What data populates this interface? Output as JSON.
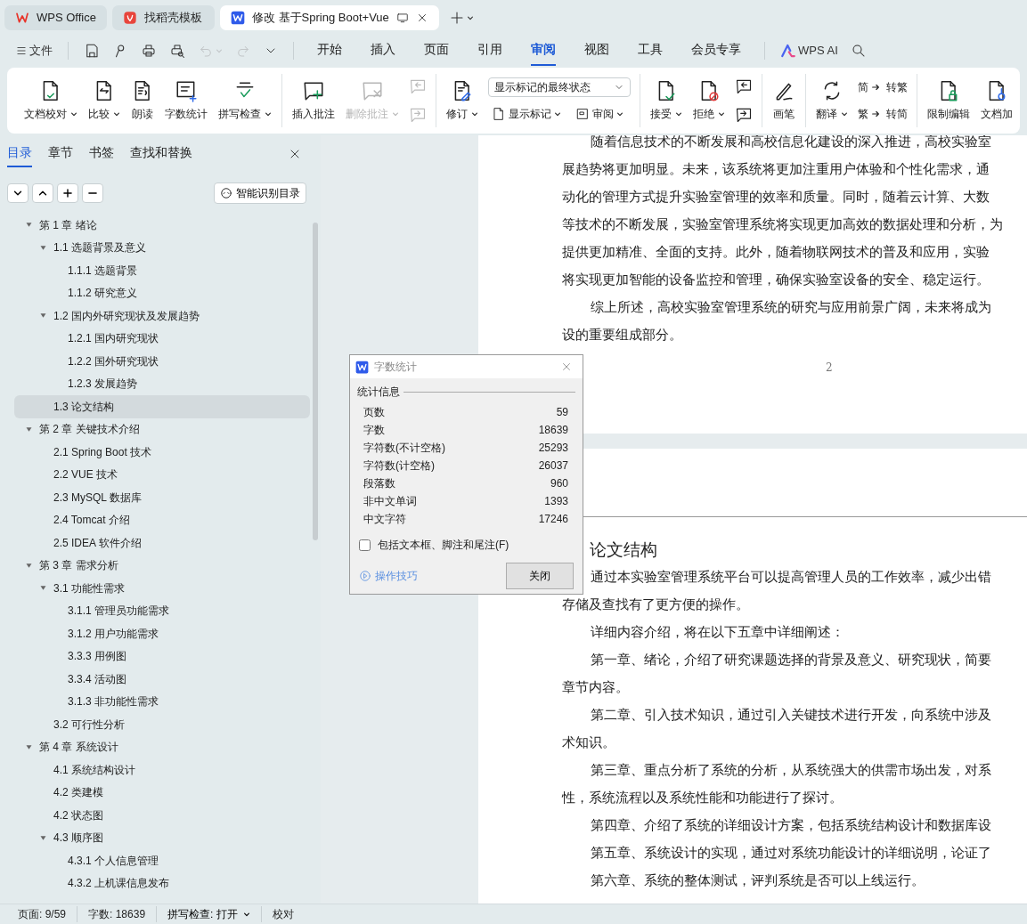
{
  "app_tabs": [
    {
      "label": "WPS Office",
      "kind": "home",
      "selected": false
    },
    {
      "label": "找稻壳模板",
      "kind": "template",
      "selected": false
    },
    {
      "label": "修改 基于Spring Boot+Vue",
      "kind": "document",
      "selected": true
    }
  ],
  "menu": {
    "file": "文件",
    "quick": [
      {
        "disabled": false
      },
      {
        "disabled": false
      },
      {
        "disabled": false
      },
      {
        "disabled": false
      },
      {
        "disabled": true
      },
      {
        "disabled": true
      }
    ],
    "tabs": [
      {
        "label": "开始",
        "selected": false
      },
      {
        "label": "插入",
        "selected": false
      },
      {
        "label": "页面",
        "selected": false
      },
      {
        "label": "引用",
        "selected": false
      },
      {
        "label": "审阅",
        "selected": true
      },
      {
        "label": "视图",
        "selected": false
      },
      {
        "label": "工具",
        "selected": false
      },
      {
        "label": "会员专享",
        "selected": false
      }
    ],
    "ai": "WPS AI"
  },
  "ribbon": [
    [
      {
        "kind": "large",
        "label": "文档校对",
        "caret": true,
        "disabled": false
      },
      {
        "kind": "large",
        "label": "比较",
        "caret": true,
        "disabled": false
      },
      {
        "kind": "large",
        "label": "朗读",
        "caret": false,
        "disabled": false
      },
      {
        "kind": "large",
        "label": "字数统计",
        "caret": false,
        "disabled": false
      },
      {
        "kind": "large",
        "label": "拼写检查",
        "caret": true,
        "disabled": false
      }
    ],
    [
      {
        "kind": "large",
        "label": "插入批注",
        "caret": false,
        "disabled": false
      },
      {
        "kind": "large",
        "label": "删除批注",
        "caret": true,
        "disabled": true
      },
      {
        "kind": "stack",
        "items": [
          {
            "disabled": true
          },
          {
            "disabled": true
          }
        ]
      }
    ],
    [
      {
        "kind": "large",
        "label": "修订",
        "caret": true,
        "disabled": false
      },
      {
        "kind": "select",
        "value": "显示标记的最终状态",
        "buttons": [
          {
            "label": "显示标记",
            "caret": true
          },
          {
            "label": "审阅",
            "caret": true
          }
        ]
      }
    ],
    [
      {
        "kind": "large",
        "label": "接受",
        "caret": true,
        "disabled": false
      },
      {
        "kind": "large",
        "label": "拒绝",
        "caret": true,
        "disabled": false
      },
      {
        "kind": "stack",
        "items": [
          {
            "disabled": false
          },
          {
            "disabled": false
          }
        ]
      }
    ],
    [
      {
        "kind": "large",
        "label": "画笔",
        "caret": false,
        "disabled": false
      }
    ],
    [
      {
        "kind": "large",
        "label": "翻译",
        "caret": true,
        "disabled": false
      },
      {
        "kind": "stack",
        "items": [
          {
            "glyph": "简",
            "label": "转繁",
            "disabled": false
          },
          {
            "glyph": "繁",
            "label": "转简",
            "disabled": false
          }
        ]
      }
    ],
    [
      {
        "kind": "large",
        "label": "限制编辑",
        "caret": false,
        "disabled": false
      },
      {
        "kind": "large",
        "label": "文档加",
        "caret": false,
        "disabled": false
      }
    ]
  ],
  "sidebar": {
    "tabs": [
      {
        "label": "目录",
        "selected": true
      },
      {
        "label": "章节",
        "selected": false
      },
      {
        "label": "书签",
        "selected": false
      },
      {
        "label": "查找和替换",
        "selected": false
      }
    ],
    "smart_button": "智能识别目录",
    "tree": [
      {
        "label": "第 1 章  绪论",
        "expanded": true,
        "selected": false,
        "children": [
          {
            "label": "1.1 选题背景及意义",
            "expanded": true,
            "selected": false,
            "children": [
              {
                "label": "1.1.1 选题背景",
                "selected": false
              },
              {
                "label": "1.1.2  研究意义",
                "selected": false
              }
            ]
          },
          {
            "label": "1.2 国内外研究现状及发展趋势",
            "expanded": true,
            "selected": false,
            "children": [
              {
                "label": "1.2.1 国内研究现状",
                "selected": false
              },
              {
                "label": "1.2.2 国外研究现状",
                "selected": false
              },
              {
                "label": "1.2.3 发展趋势",
                "selected": false
              }
            ]
          },
          {
            "label": "1.3 论文结构",
            "selected": true
          }
        ]
      },
      {
        "label": "第 2 章  关键技术介绍",
        "expanded": true,
        "selected": false,
        "children": [
          {
            "label": "2.1 Spring Boot 技术",
            "selected": false
          },
          {
            "label": "2.2 VUE 技术",
            "selected": false
          },
          {
            "label": "2.3 MySQL 数据库",
            "selected": false
          },
          {
            "label": "2.4 Tomcat 介绍",
            "selected": false
          },
          {
            "label": "2.5 IDEA 软件介绍",
            "selected": false
          }
        ]
      },
      {
        "label": "第 3 章  需求分析",
        "expanded": true,
        "selected": false,
        "children": [
          {
            "label": "3.1  功能性需求",
            "expanded": true,
            "selected": false,
            "children": [
              {
                "label": "3.1.1  管理员功能需求",
                "selected": false
              },
              {
                "label": "3.1.2  用户功能需求",
                "selected": false
              },
              {
                "label": "3.3.3 用例图",
                "selected": false
              },
              {
                "label": "3.3.4 活动图",
                "selected": false
              },
              {
                "label": "3.1.3  非功能性需求",
                "selected": false
              }
            ]
          },
          {
            "label": "3.2  可行性分析",
            "selected": false
          }
        ]
      },
      {
        "label": "第 4 章  系统设计",
        "expanded": true,
        "selected": false,
        "children": [
          {
            "label": "4.1  系统结构设计",
            "selected": false
          },
          {
            "label": "4.2  类建模",
            "selected": false
          },
          {
            "label": "4.2  状态图",
            "selected": false
          },
          {
            "label": "4.3  顺序图",
            "expanded": true,
            "selected": false,
            "children": [
              {
                "label": "4.3.1  个人信息管理",
                "selected": false
              },
              {
                "label": "4.3.2  上机课信息发布",
                "selected": false
              }
            ]
          }
        ]
      }
    ]
  },
  "pages": [
    {
      "lines": [
        {
          "text": "随着信息技术的不断发展和高校信息化建设的深入推进，高校实验室",
          "kind": "first"
        },
        {
          "text": "展趋势将更加明显。未来，该系统将更加注重用户体验和个性化需求，通",
          "kind": "continuation"
        },
        {
          "text": "动化的管理方式提升实验室管理的效率和质量。同时，随着云计算、大数",
          "kind": "continuation"
        },
        {
          "text": "等技术的不断发展，实验室管理系统将实现更加高效的数据处理和分析，为",
          "kind": "continuation"
        },
        {
          "text": "提供更加精准、全面的支持。此外，随着物联网技术的普及和应用，实验",
          "kind": "continuation"
        },
        {
          "text": "将实现更加智能的设备监控和管理，确保实验室设备的安全、稳定运行。",
          "kind": "continuation"
        },
        {
          "text": "综上所述，高校实验室管理系统的研究与应用前景广阔，未来将成为",
          "kind": "first"
        },
        {
          "text": "设的重要组成部分。",
          "kind": "continuation"
        }
      ],
      "page_number": "2"
    },
    {
      "heading": "论文结构",
      "lines": [
        {
          "text": "通过本实验室管理系统平台可以提高管理人员的工作效率，减少出错",
          "kind": "first"
        },
        {
          "text": "存储及查找有了更方便的操作。",
          "kind": "continuation"
        },
        {
          "text": "详细内容介绍，将在以下五章中详细阐述：",
          "kind": "first"
        },
        {
          "text": "第一章、绪论，介绍了研究课题选择的背景及意义、研究现状，简要",
          "kind": "first"
        },
        {
          "text": "章节内容。",
          "kind": "continuation"
        },
        {
          "text": "第二章、引入技术知识，通过引入关键技术进行开发，向系统中涉及",
          "kind": "first"
        },
        {
          "text": "术知识。",
          "kind": "continuation"
        },
        {
          "text": "第三章、重点分析了系统的分析，从系统强大的供需市场出发，对系",
          "kind": "first"
        },
        {
          "text": "性，系统流程以及系统性能和功能进行了探讨。",
          "kind": "continuation"
        },
        {
          "text": "第四章、介绍了系统的详细设计方案，包括系统结构设计和数据库设",
          "kind": "first"
        },
        {
          "text": "第五章、系统设计的实现，通过对系统功能设计的详细说明，论证了",
          "kind": "first"
        },
        {
          "text": "第六章、系统的整体测试，评判系统是否可以上线运行。",
          "kind": "first"
        }
      ]
    }
  ],
  "dialog": {
    "title": "字数统计",
    "group": "统计信息",
    "rows": [
      {
        "label": "页数",
        "value": "59"
      },
      {
        "label": "字数",
        "value": "18639"
      },
      {
        "label": "字符数(不计空格)",
        "value": "25293"
      },
      {
        "label": "字符数(计空格)",
        "value": "26037"
      },
      {
        "label": "段落数",
        "value": "960"
      },
      {
        "label": "非中文单词",
        "value": "1393"
      },
      {
        "label": "中文字符",
        "value": "17246"
      }
    ],
    "checkbox": {
      "label": "包括文本框、脚注和尾注(F)",
      "checked": false
    },
    "tips_link": "操作技巧",
    "close_button": "关闭"
  },
  "status_bar": [
    {
      "label": "页面: 9/59",
      "caret": false
    },
    {
      "label": "字数: 18639",
      "caret": false
    },
    {
      "label": "拼写检查: 打开",
      "caret": true
    },
    {
      "label": "校对",
      "caret": false
    }
  ]
}
